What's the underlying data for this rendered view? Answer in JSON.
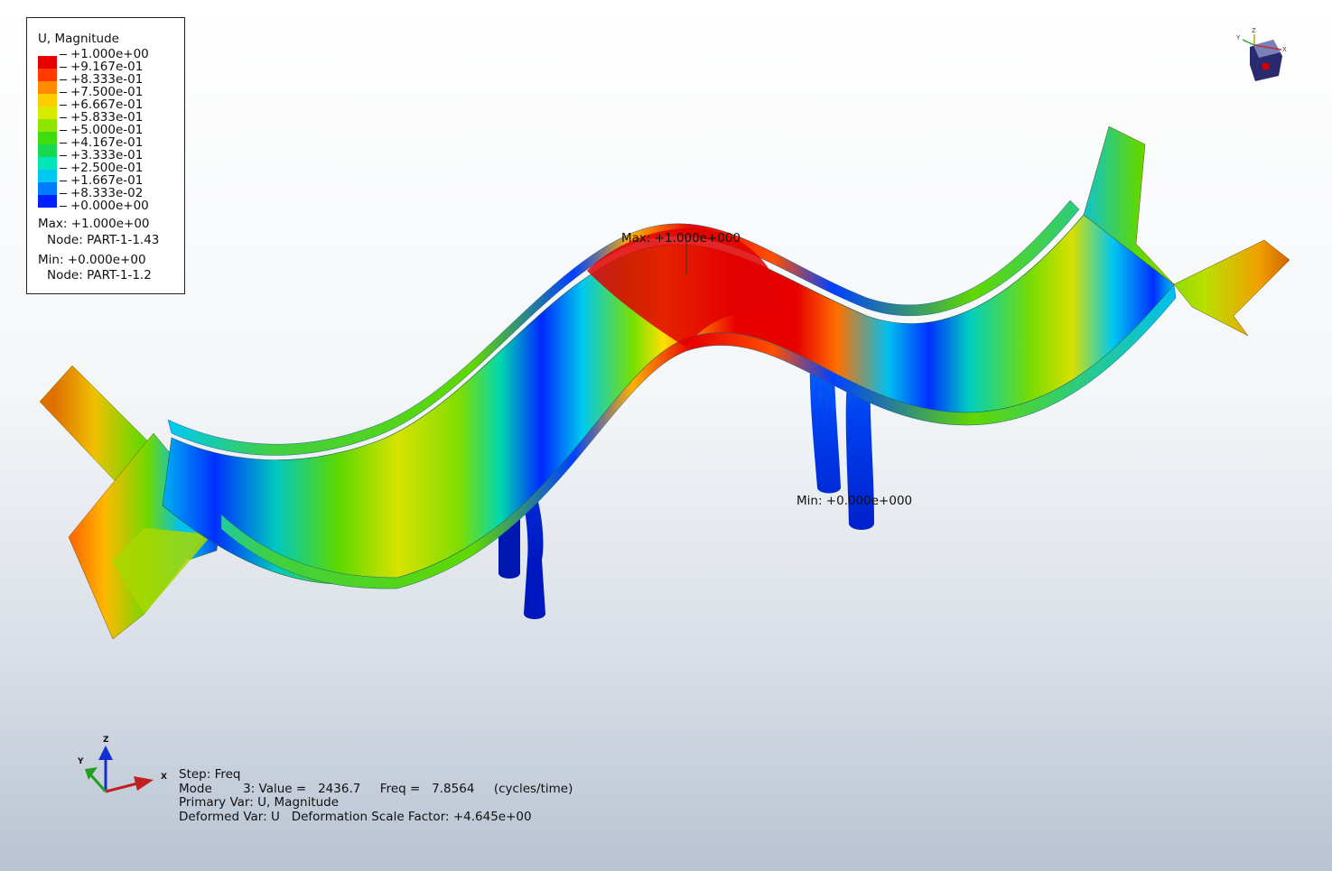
{
  "legend": {
    "title": "U, Magnitude",
    "colors": [
      "#e80000",
      "#ff3a00",
      "#ff8a00",
      "#ffcc00",
      "#d8ea00",
      "#8ee600",
      "#3edc10",
      "#18d850",
      "#00e6b8",
      "#00c8f0",
      "#007cff",
      "#0020ff"
    ],
    "ticks": [
      "+1.000e+00",
      "+9.167e-01",
      "+8.333e-01",
      "+7.500e-01",
      "+6.667e-01",
      "+5.833e-01",
      "+5.000e-01",
      "+4.167e-01",
      "+3.333e-01",
      "+2.500e-01",
      "+1.667e-01",
      "+8.333e-02",
      "+0.000e+00"
    ],
    "max_line": "Max: +1.000e+00",
    "max_node": "Node: PART-1-1.43",
    "min_line": "Min: +0.000e+00",
    "min_node": "Node: PART-1-1.2"
  },
  "annotations": {
    "max": "Max: +1.000e+000",
    "min": "Min: +0.000e+000"
  },
  "info": {
    "step": "Step: Freq",
    "mode": "Mode        3: Value =   2436.7     Freq =   7.8564     (cycles/time)",
    "primary": "Primary Var: U, Magnitude",
    "deformed": "Deformed Var: U   Deformation Scale Factor: +4.645e+00"
  },
  "triad": {
    "x": "X",
    "y": "Y",
    "z": "Z"
  },
  "view_cube": {
    "x": "X",
    "y": "Y",
    "z": "Z"
  }
}
